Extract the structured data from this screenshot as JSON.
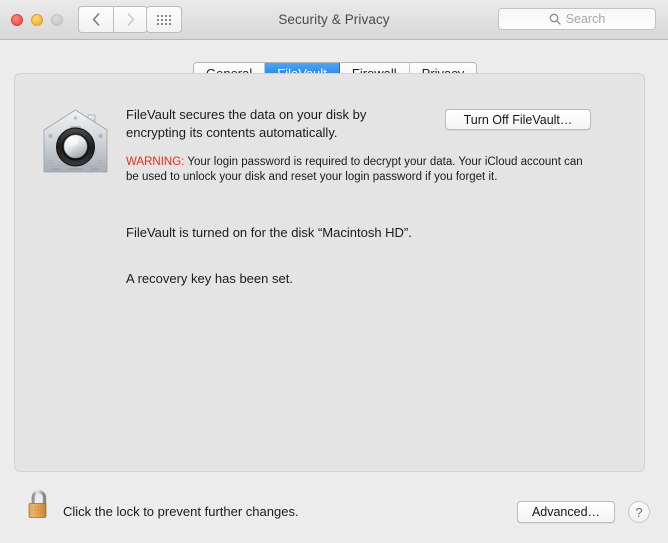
{
  "window": {
    "title": "Security & Privacy",
    "traffic_lights": [
      {
        "name": "close",
        "color": "#f2605a"
      },
      {
        "name": "minimize",
        "color": "#f7bd45"
      },
      {
        "name": "maximize",
        "color": "#cdcdcd"
      }
    ],
    "nav": {
      "back_icon": "chevron-left-icon",
      "forward_icon": "chevron-right-icon",
      "show_all_icon": "grid-dots-icon"
    },
    "search": {
      "placeholder": "Search",
      "icon": "search-icon",
      "value": ""
    }
  },
  "tabs": [
    {
      "label": "General",
      "active": false
    },
    {
      "label": "FileVault",
      "active": true
    },
    {
      "label": "Firewall",
      "active": false
    },
    {
      "label": "Privacy",
      "active": false
    }
  ],
  "filevault": {
    "icon": "filevault-house-vault-icon",
    "description": "FileVault secures the data on your disk by encrypting its contents automatically.",
    "turn_off_button": "Turn Off FileVault…",
    "warning_label": "WARNING:",
    "warning_text": " Your login password is required to decrypt your data. Your iCloud account can be used to unlock your disk and reset your login password if you forget it.",
    "status_line_1": "FileVault is turned on for the disk “Macintosh HD”.",
    "status_line_2": "A recovery key has been set."
  },
  "footer": {
    "lock_icon": "unlocked-padlock-icon",
    "lock_message": "Click the lock to prevent further changes.",
    "advanced_button": "Advanced…",
    "help_button": "?"
  },
  "colors": {
    "accent_blue": "#1277e0",
    "warning_red": "#ef2b18",
    "window_bg": "#ececec",
    "panel_bg": "#e4e4e4",
    "help_blue": "#3d76c9"
  }
}
